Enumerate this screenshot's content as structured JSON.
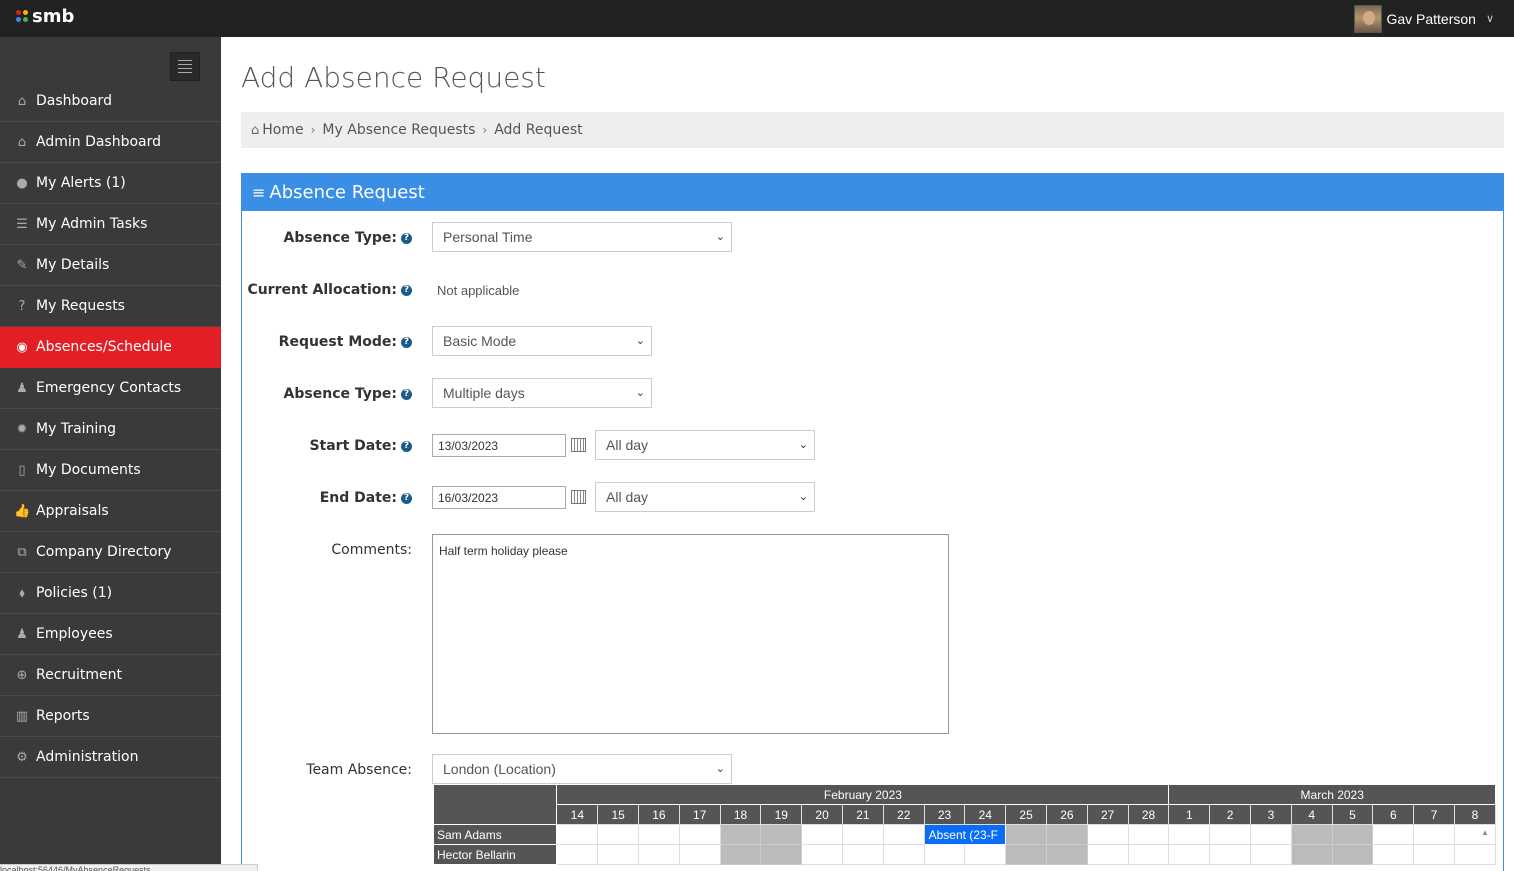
{
  "topbar": {
    "logo": "smb",
    "user_name": "Gav Patterson"
  },
  "sidebar": {
    "items": [
      {
        "label": "Dashboard",
        "icon": "home-icon",
        "glyph": "⌂"
      },
      {
        "label": "Admin Dashboard",
        "icon": "home-icon",
        "glyph": "⌂"
      },
      {
        "label": "My Alerts (1)",
        "icon": "alert-icon",
        "glyph": "●"
      },
      {
        "label": "My Admin Tasks",
        "icon": "tasks-icon",
        "glyph": "☰"
      },
      {
        "label": "My Details",
        "icon": "edit-icon",
        "glyph": "✎"
      },
      {
        "label": "My Requests",
        "icon": "question-icon",
        "glyph": "?"
      },
      {
        "label": "Absences/Schedule",
        "icon": "globe-icon",
        "glyph": "◉"
      },
      {
        "label": "Emergency Contacts",
        "icon": "group-icon",
        "glyph": "♟"
      },
      {
        "label": "My Training",
        "icon": "cog-icon",
        "glyph": "✹"
      },
      {
        "label": "My Documents",
        "icon": "document-icon",
        "glyph": "▯"
      },
      {
        "label": "Appraisals",
        "icon": "thumbs-up-icon",
        "glyph": "👍"
      },
      {
        "label": "Company Directory",
        "icon": "sitemap-icon",
        "glyph": "⧉"
      },
      {
        "label": "Policies (1)",
        "icon": "tags-icon",
        "glyph": "⬧"
      },
      {
        "label": "Employees",
        "icon": "users-icon",
        "glyph": "♟"
      },
      {
        "label": "Recruitment",
        "icon": "plus-circle-icon",
        "glyph": "⊕"
      },
      {
        "label": "Reports",
        "icon": "bar-chart-icon",
        "glyph": "▥"
      },
      {
        "label": "Administration",
        "icon": "cogs-icon",
        "glyph": "⚙"
      }
    ],
    "active_index": 6
  },
  "page": {
    "title": "Add Absence Request",
    "breadcrumb": [
      "Home",
      "My Absence Requests",
      "Add Request"
    ]
  },
  "panel": {
    "title": "Absence Request",
    "absence_type_label": "Absence Type:",
    "absence_type_value": "Personal Time",
    "current_allocation_label": "Current Allocation:",
    "current_allocation_value": "Not applicable",
    "request_mode_label": "Request Mode:",
    "request_mode_value": "Basic Mode",
    "absence_type2_label": "Absence Type:",
    "absence_type2_value": "Multiple days",
    "start_date_label": "Start Date:",
    "start_date_value": "13/03/2023",
    "start_period_value": "All day",
    "end_date_label": "End Date:",
    "end_date_value": "16/03/2023",
    "end_period_value": "All day",
    "comments_label": "Comments:",
    "comments_value": "Half term holiday please",
    "team_absence_label": "Team Absence:",
    "team_absence_value": "London (Location)"
  },
  "team_grid": {
    "months": [
      {
        "label": "February 2023",
        "days": [
          "14",
          "15",
          "16",
          "17",
          "18",
          "19",
          "20",
          "21",
          "22",
          "23",
          "24",
          "25",
          "26",
          "27",
          "28"
        ]
      },
      {
        "label": "March 2023",
        "days": [
          "1",
          "2",
          "3",
          "4",
          "5",
          "6",
          "7",
          "8"
        ]
      }
    ],
    "weekend_days": [
      "18",
      "19",
      "25",
      "26",
      "4",
      "5"
    ],
    "rows": [
      {
        "name": "Sam Adams",
        "absence": {
          "start_day": "23",
          "span": 2,
          "label": "Absent (23-F"
        }
      },
      {
        "name": "Hector Bellarin"
      }
    ]
  },
  "status": {
    "text": "localhost:56446/MyAbsenceRequests"
  }
}
